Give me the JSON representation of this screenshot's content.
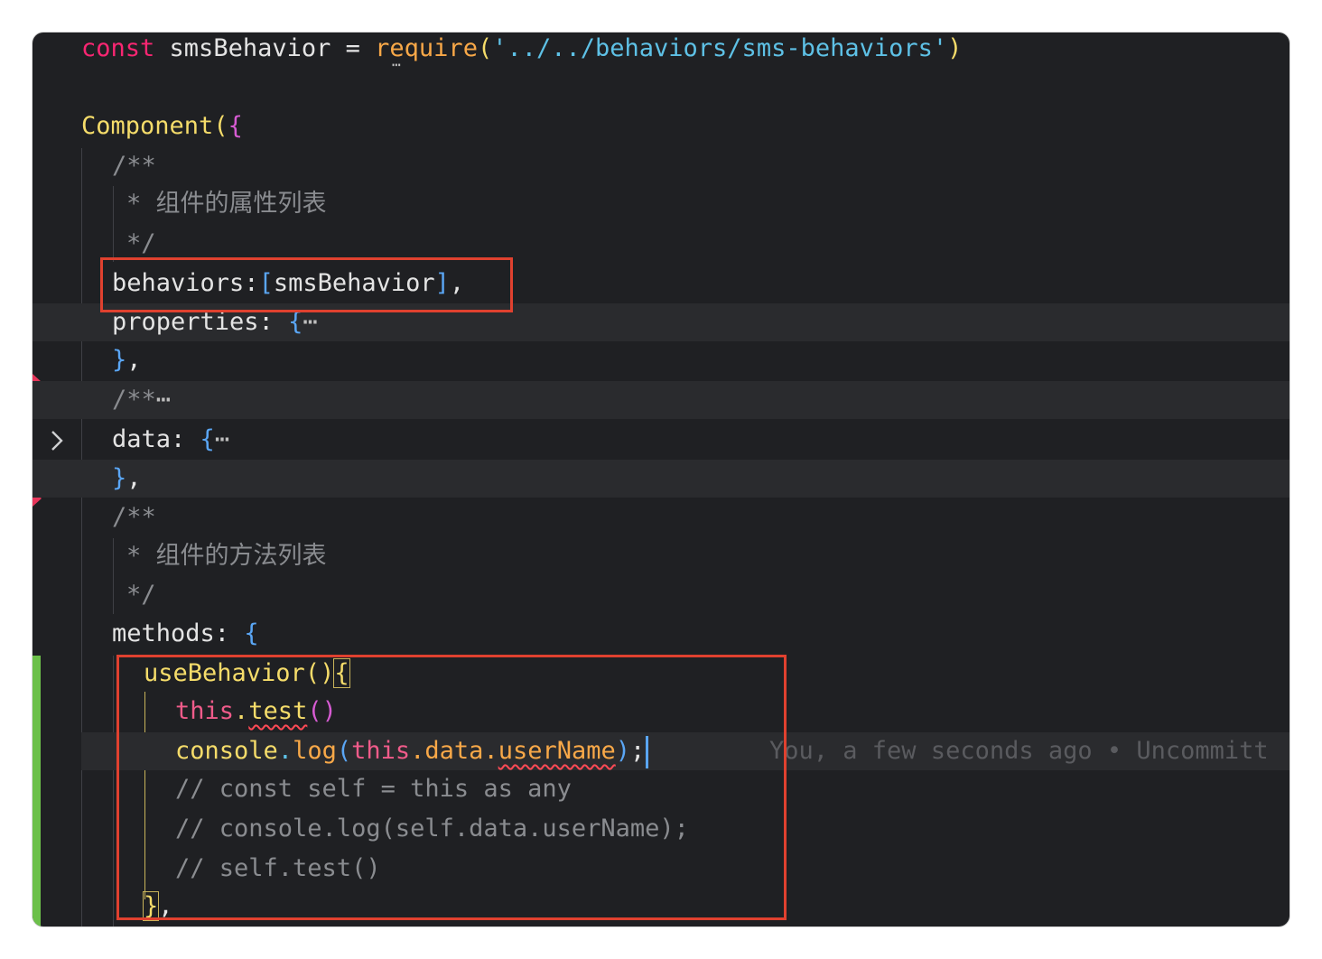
{
  "editor": {
    "line1": {
      "keyword": "const",
      "name": "smsBehavior",
      "eq": "=",
      "fn": "require",
      "open": "(",
      "path": "'../../behaviors/sms-behaviors'",
      "close": ")"
    },
    "line3": {
      "fn": "Component",
      "open_paren": "(",
      "open_brace": "{"
    },
    "comment1": {
      "start": "/**",
      "body": "* 组件的属性列表",
      "end": "*/"
    },
    "behaviors_line": {
      "key": "behaviors:",
      "open": "[",
      "value": "smsBehavior",
      "close": "]",
      "comma": ","
    },
    "properties_line": {
      "key": "properties:",
      "brace": "{",
      "ellipsis": "⋯"
    },
    "properties_close": {
      "brace": "}",
      "comma": ","
    },
    "collapsed_comment": {
      "start": "/**",
      "ellipsis": "⋯"
    },
    "data_line": {
      "key": "data:",
      "brace": "{",
      "ellipsis": "⋯"
    },
    "data_close": {
      "brace": "}",
      "comma": ","
    },
    "comment2": {
      "start": "/**",
      "body": "* 组件的方法列表",
      "end": "*/"
    },
    "methods_line": {
      "key": "methods:",
      "brace": "{"
    },
    "use_behavior": {
      "fn": "useBehavior",
      "parens": "()",
      "brace": "{"
    },
    "this_test": {
      "this": "this",
      "dot": ".",
      "fn": "test",
      "parens": "()"
    },
    "console_line": {
      "obj": "console",
      "dot1": ".",
      "fn": "log",
      "open": "(",
      "this": "this",
      "dot2": ".",
      "data": "data",
      "dot3": ".",
      "member": "userName",
      "close": ")",
      "semi": ";"
    },
    "blame": "You, a few seconds ago • Uncommitt",
    "comment_line1": "// const self = this as any",
    "comment_line2": "// console.log(self.data.userName);",
    "comment_line3": "// self.test()",
    "method_close": {
      "brace": "}",
      "comma": ","
    }
  },
  "colors": {
    "background": "#1f2023",
    "keyword": "#f92672",
    "function": "#f5dc6a",
    "string": "#5ec1e6",
    "comment": "#8a8c90",
    "annotation_box": "#e0412f",
    "git_added": "#6cc04a"
  },
  "icons": {
    "fold": "chevron-right-icon",
    "breakpoint": "red-triangle-marker-icon"
  }
}
